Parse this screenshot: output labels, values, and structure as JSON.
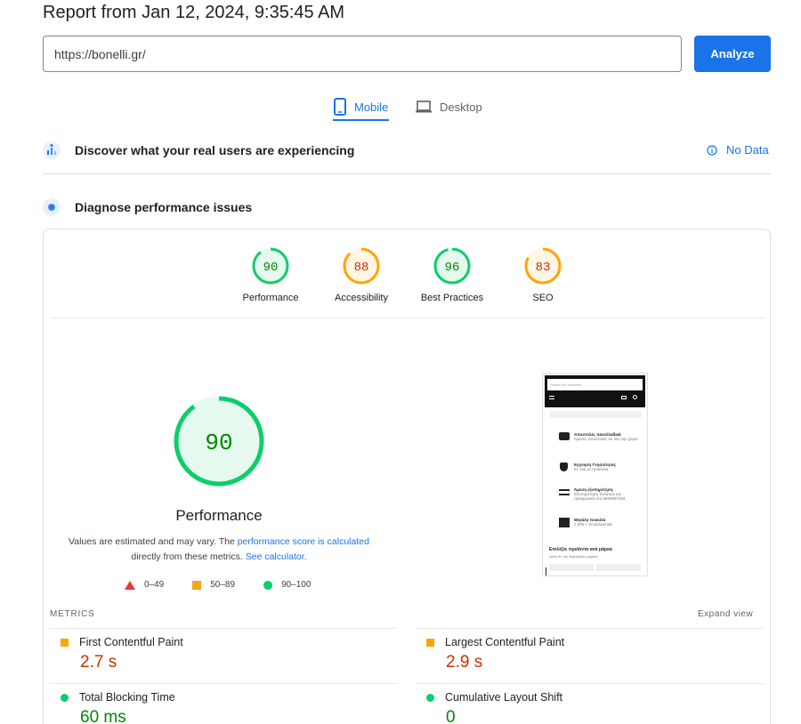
{
  "header": {
    "report_title": "Report from Jan 12, 2024, 9:35:45 AM",
    "url_value": "https://bonelli.gr/",
    "analyze_label": "Analyze"
  },
  "tabs": [
    {
      "label": "Mobile",
      "icon": "smartphone-icon",
      "active": true
    },
    {
      "label": "Desktop",
      "icon": "laptop-icon",
      "active": false
    }
  ],
  "crux": {
    "title": "Discover what your real users are experiencing",
    "no_data": "No Data"
  },
  "diagnose": {
    "title": "Diagnose performance issues"
  },
  "scores": [
    {
      "label": "Performance",
      "value": 90,
      "status": "good"
    },
    {
      "label": "Accessibility",
      "value": 88,
      "status": "average"
    },
    {
      "label": "Best Practices",
      "value": 96,
      "status": "good"
    },
    {
      "label": "SEO",
      "value": 83,
      "status": "average"
    }
  ],
  "performance": {
    "score": 90,
    "title": "Performance",
    "note_part1": "Values are estimated and may vary. The ",
    "note_link1": "performance score is calculated",
    "note_part2": "directly from these metrics. ",
    "note_link2": "See calculator."
  },
  "legend": {
    "poor": "0–49",
    "average": "50–89",
    "good": "90–100"
  },
  "thumbnail": {
    "search_placeholder": "Search for products...",
    "features": [
      {
        "title": "Αποστολές πανελλαδικά",
        "sub": "Άμεσες αποστολές σε όλη την χώρα"
      },
      {
        "title": "Εγγύηση Γνησιότητας",
        "sub": "Σε όλα τα προϊόντα"
      },
      {
        "title": "Άμεση εξυπηρέτηση",
        "sub": "Εξυπηρέτηση πελατών και τηλεφωνικά στο 6934997284"
      },
      {
        "title": "Μεγάλη ποικιλία",
        "sub": "1.000 + ανταλλακτικά"
      }
    ],
    "brand_heading": "Επιλέξτε προϊόντα ανά μάρκα",
    "brand_sub": "Δείτε τις πιο δημοφιλείς μάρκες"
  },
  "metrics": {
    "label": "METRICS",
    "expand": "Expand view",
    "items": [
      {
        "name": "First Contentful Paint",
        "value": "2.7 s",
        "status": "average"
      },
      {
        "name": "Largest Contentful Paint",
        "value": "2.9 s",
        "status": "average"
      },
      {
        "name": "Total Blocking Time",
        "value": "60 ms",
        "status": "good"
      },
      {
        "name": "Cumulative Layout Shift",
        "value": "0",
        "status": "good"
      }
    ]
  },
  "colors": {
    "accent": "#1a73e8",
    "good": "#0cce6b",
    "good_text": "#008800",
    "average": "#ffa400",
    "average_text": "#c33300",
    "poor": "#ff4e42"
  }
}
